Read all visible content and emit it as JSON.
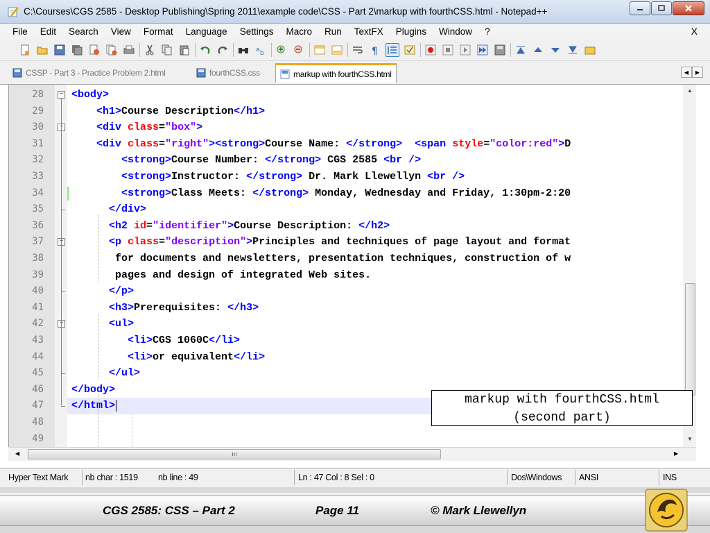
{
  "window": {
    "title": "C:\\Courses\\CGS 2585 - Desktop Publishing\\Spring 2011\\example code\\CSS - Part 2\\markup with fourthCSS.html - Notepad++"
  },
  "menu": {
    "items": [
      "File",
      "Edit",
      "Search",
      "View",
      "Format",
      "Language",
      "Settings",
      "Macro",
      "Run",
      "TextFX",
      "Plugins",
      "Window",
      "?"
    ],
    "close": "X"
  },
  "tabs": [
    {
      "label": "CSSP - Part 3 - Practice Problem 2.html",
      "active": false
    },
    {
      "label": "fourthCSS.css",
      "active": false
    },
    {
      "label": "markup with fourthCSS.html",
      "active": true
    }
  ],
  "editor": {
    "lines": [
      {
        "n": "28",
        "code": [
          [
            "t",
            "<body>"
          ]
        ]
      },
      {
        "n": "29",
        "code": [
          [
            "s",
            "    "
          ],
          [
            "t",
            "<h1>"
          ],
          [
            "x",
            "Course Description"
          ],
          [
            "t",
            "</h1>"
          ]
        ]
      },
      {
        "n": "30",
        "code": [
          [
            "s",
            "    "
          ],
          [
            "t",
            "<div "
          ],
          [
            "a",
            "class"
          ],
          [
            "x",
            "="
          ],
          [
            "v",
            "\"box\""
          ],
          [
            "t",
            ">"
          ]
        ]
      },
      {
        "n": "31",
        "code": [
          [
            "s",
            "    "
          ],
          [
            "t",
            "<div "
          ],
          [
            "a",
            "class"
          ],
          [
            "x",
            "="
          ],
          [
            "v",
            "\"right\""
          ],
          [
            "t",
            ">"
          ],
          [
            "t",
            "<strong>"
          ],
          [
            "x",
            "Course Name: "
          ],
          [
            "t",
            "</strong>"
          ],
          [
            "x",
            "  "
          ],
          [
            "t",
            "<span "
          ],
          [
            "a",
            "style"
          ],
          [
            "x",
            "="
          ],
          [
            "v",
            "\"color:red\""
          ],
          [
            "t",
            ">"
          ],
          [
            "x",
            "D"
          ]
        ]
      },
      {
        "n": "32",
        "code": [
          [
            "s",
            "        "
          ],
          [
            "t",
            "<strong>"
          ],
          [
            "x",
            "Course Number: "
          ],
          [
            "t",
            "</strong>"
          ],
          [
            "x",
            " CGS 2585 "
          ],
          [
            "t",
            "<br />"
          ]
        ]
      },
      {
        "n": "33",
        "code": [
          [
            "s",
            "        "
          ],
          [
            "t",
            "<strong>"
          ],
          [
            "x",
            "Instructor: "
          ],
          [
            "t",
            "</strong>"
          ],
          [
            "x",
            " Dr. Mark Llewellyn "
          ],
          [
            "t",
            "<br />"
          ]
        ]
      },
      {
        "n": "34",
        "code": [
          [
            "s",
            "        "
          ],
          [
            "t",
            "<strong>"
          ],
          [
            "x",
            "Class Meets: "
          ],
          [
            "t",
            "</strong>"
          ],
          [
            "x",
            " Monday, Wednesday and Friday, 1:30pm-2:20"
          ]
        ]
      },
      {
        "n": "35",
        "code": [
          [
            "s",
            "      "
          ],
          [
            "t",
            "</div>"
          ]
        ]
      },
      {
        "n": "36",
        "code": [
          [
            "s",
            "      "
          ],
          [
            "t",
            "<h2 "
          ],
          [
            "a",
            "id"
          ],
          [
            "x",
            "="
          ],
          [
            "v",
            "\"identifier\""
          ],
          [
            "t",
            ">"
          ],
          [
            "x",
            "Course Description: "
          ],
          [
            "t",
            "</h2>"
          ]
        ]
      },
      {
        "n": "37",
        "code": [
          [
            "s",
            "      "
          ],
          [
            "t",
            "<p "
          ],
          [
            "a",
            "class"
          ],
          [
            "x",
            "="
          ],
          [
            "v",
            "\"description\""
          ],
          [
            "t",
            ">"
          ],
          [
            "x",
            "Principles and techniques of page layout and format"
          ]
        ]
      },
      {
        "n": "38",
        "code": [
          [
            "s",
            "       "
          ],
          [
            "x",
            "for documents and newsletters, presentation techniques, construction of w"
          ]
        ]
      },
      {
        "n": "39",
        "code": [
          [
            "s",
            "       "
          ],
          [
            "x",
            "pages and design of integrated Web sites."
          ]
        ]
      },
      {
        "n": "40",
        "code": [
          [
            "s",
            "      "
          ],
          [
            "t",
            "</p>"
          ]
        ]
      },
      {
        "n": "41",
        "code": [
          [
            "s",
            "      "
          ],
          [
            "t",
            "<h3>"
          ],
          [
            "x",
            "Prerequisites: "
          ],
          [
            "t",
            "</h3>"
          ]
        ]
      },
      {
        "n": "42",
        "code": [
          [
            "s",
            "      "
          ],
          [
            "t",
            "<ul>"
          ]
        ]
      },
      {
        "n": "43",
        "code": [
          [
            "s",
            "         "
          ],
          [
            "t",
            "<li>"
          ],
          [
            "x",
            "CGS 1060C"
          ],
          [
            "t",
            "</li>"
          ]
        ]
      },
      {
        "n": "44",
        "code": [
          [
            "s",
            "         "
          ],
          [
            "t",
            "<li>"
          ],
          [
            "x",
            "or equivalent"
          ],
          [
            "t",
            "</li>"
          ]
        ]
      },
      {
        "n": "45",
        "code": [
          [
            "s",
            "      "
          ],
          [
            "t",
            "</ul>"
          ]
        ]
      },
      {
        "n": "46",
        "code": [
          [
            "t",
            "</body>"
          ]
        ]
      },
      {
        "n": "47",
        "code": [
          [
            "t",
            "</html>"
          ]
        ]
      },
      {
        "n": "48",
        "code": []
      },
      {
        "n": "49",
        "code": []
      }
    ],
    "current_line": "47"
  },
  "caption": {
    "line1": "markup with fourthCSS.html",
    "line2": "(second part)"
  },
  "status": {
    "lang": "Hyper Text Mark",
    "chars": "nb char : 1519",
    "lines": "nb line : 49",
    "pos": "Ln : 47    Col : 8    Sel : 0",
    "eol": "Dos\\Windows",
    "encoding": "ANSI",
    "mode": "INS"
  },
  "footer": {
    "course": "CGS 2585: CSS – Part 2",
    "page": "Page 11",
    "author": "© Mark Llewellyn"
  },
  "colors": {
    "tag": "#0000ff",
    "attr": "#ff0000",
    "value": "#8000ff",
    "text": "#000000",
    "current_line": "#e8e8ff",
    "active_tab_accent": "#f7a21b"
  },
  "icons": [
    "notepad-icon",
    "minimize-icon",
    "maximize-icon",
    "close-icon",
    "new-icon",
    "open-icon",
    "save-icon",
    "save-all-icon",
    "close-file-icon",
    "close-all-icon",
    "print-icon",
    "cut-icon",
    "copy-icon",
    "paste-icon",
    "undo-icon",
    "redo-icon",
    "find-icon",
    "replace-icon",
    "zoom-in-icon",
    "zoom-out-icon",
    "sync-v-icon",
    "sync-h-icon",
    "wrap-icon",
    "all-chars-icon",
    "indent-guide-icon",
    "user-lang-icon",
    "record-icon",
    "stop-icon",
    "play-icon",
    "run-multiple-icon",
    "save-macro-icon",
    "sort-asc-icon",
    "up-icon",
    "down-icon",
    "sort-desc-icon",
    "ucf-logo-icon"
  ]
}
